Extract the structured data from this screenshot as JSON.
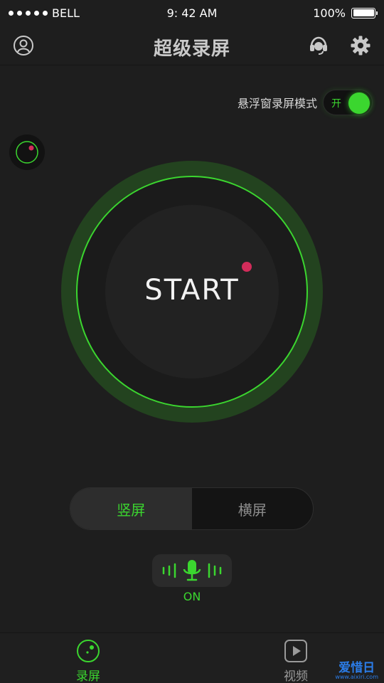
{
  "status_bar": {
    "carrier": "BELL",
    "time": "9: 42 AM",
    "battery_percent": "100%"
  },
  "header": {
    "title": "超级录屏",
    "icons": {
      "left": "user-account-icon",
      "right_1": "customer-service-headset-icon",
      "right_2": "gear-icon"
    }
  },
  "float_mode": {
    "label": "悬浮窗录屏模式",
    "toggle_text": "开",
    "enabled": true
  },
  "record": {
    "start_label": "START"
  },
  "orientation": {
    "options": [
      "竖屏",
      "横屏"
    ],
    "selected": "竖屏"
  },
  "mic": {
    "icon": "microphone-icon",
    "status": "ON"
  },
  "tabbar": {
    "tabs": [
      {
        "label": "录屏",
        "icon": "record-tab-icon",
        "active": true
      },
      {
        "label": "视频",
        "icon": "video-play-icon",
        "active": false
      }
    ]
  },
  "watermark": {
    "main": "爱惜日",
    "sub": "www.aixiri.com"
  },
  "colors": {
    "accent": "#3bd62f",
    "record_dot": "#d22c5a",
    "background": "#1e1e1e"
  }
}
